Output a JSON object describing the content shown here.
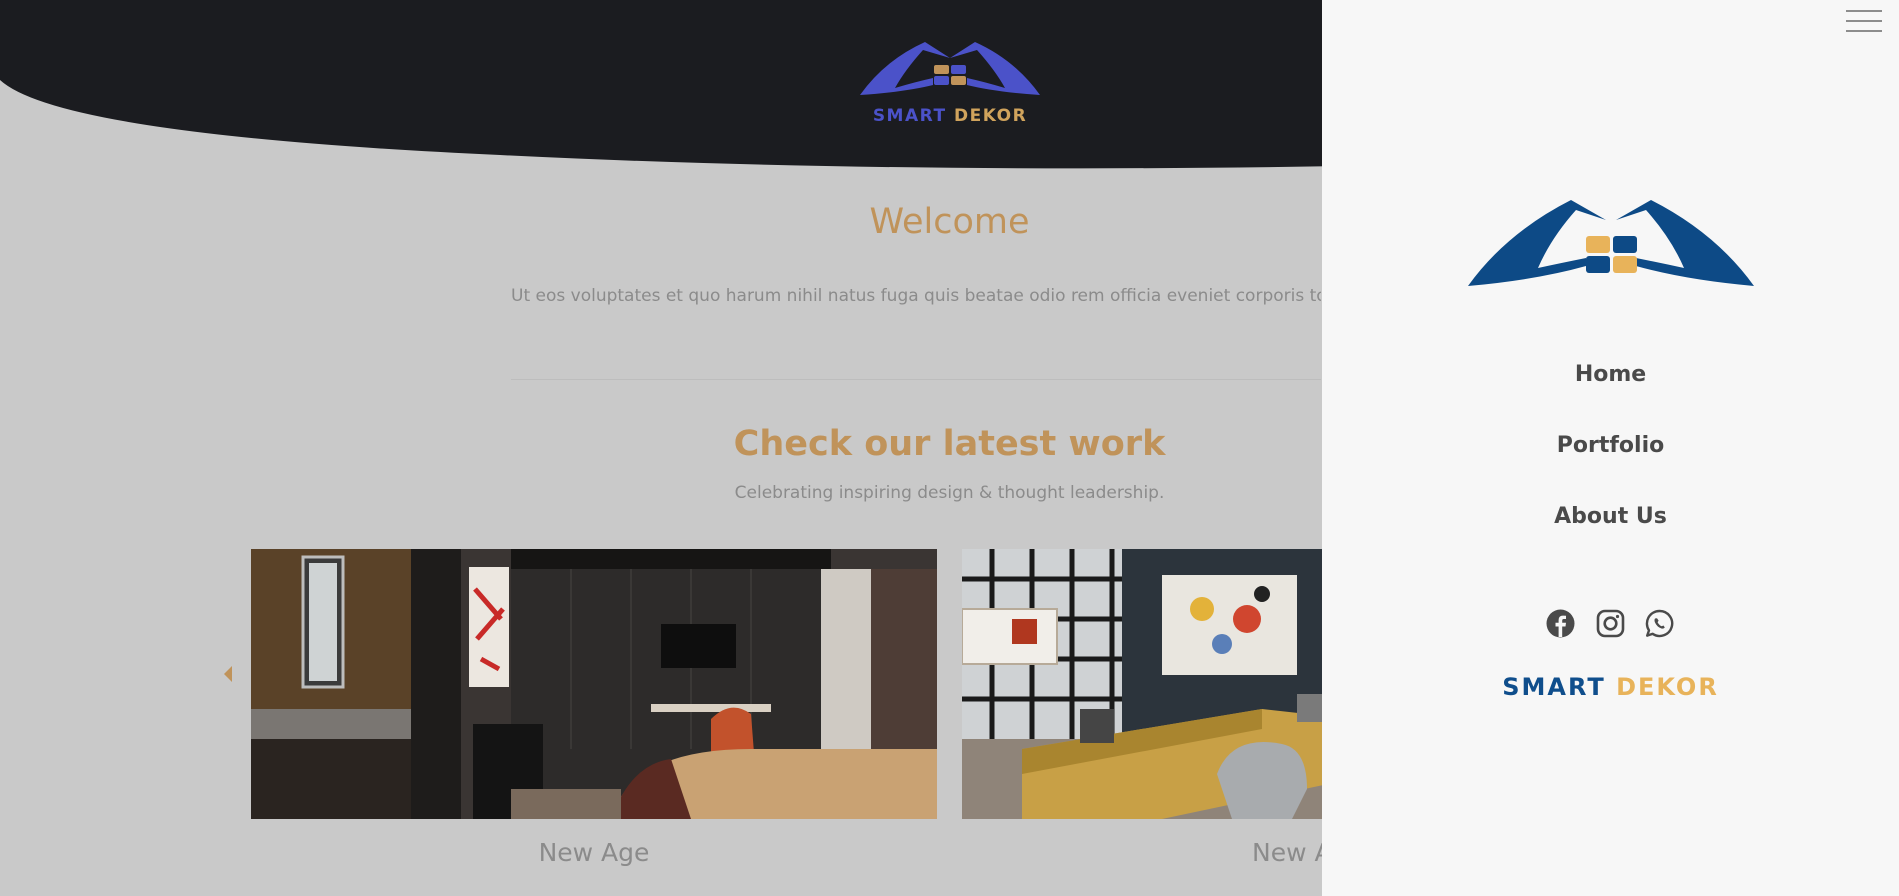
{
  "colors": {
    "header_bg": "#1b1c20",
    "page_bg": "#c9c9c9",
    "panel_bg": "#f7f7f7",
    "accent_gold": "#c0935a",
    "brand_blue": "#4b52c9",
    "panel_brand_blue": "#0f4e8c",
    "panel_brand_gold": "#e8b35a"
  },
  "header": {
    "logo_icon": "hands-house-logo-icon",
    "brand_first": "SMART",
    "brand_second": "DEKOR"
  },
  "welcome": {
    "title": "Welcome",
    "text": "Ut eos voluptates et quo harum nihil natus fuga quis beatae odio rem officia eveniet corporis totam aut"
  },
  "work": {
    "title": "Check our latest work",
    "subtitle": "Celebrating inspiring design & thought leadership.",
    "prev_icon": "caret-left-icon",
    "items": [
      {
        "caption": "New Age",
        "image": "bedroom-photo"
      },
      {
        "caption": "New A",
        "image": "living-room-photo"
      }
    ]
  },
  "side_menu": {
    "toggle_icon": "hamburger-menu-icon",
    "logo_icon": "hands-house-logo-icon",
    "items": [
      {
        "label": "Home"
      },
      {
        "label": "Portfolio"
      },
      {
        "label": "About Us"
      }
    ],
    "socials": [
      {
        "icon": "facebook-icon"
      },
      {
        "icon": "instagram-icon"
      },
      {
        "icon": "whatsapp-icon"
      }
    ],
    "brand_first": "SMART",
    "brand_second": "DEKOR"
  }
}
